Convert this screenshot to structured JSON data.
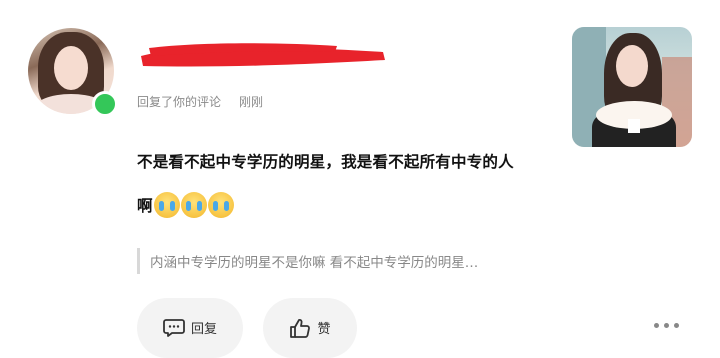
{
  "user": {
    "online_color": "#34c759",
    "action_text": "回复了你的评论",
    "time_text": "刚刚"
  },
  "comment": {
    "line1": "不是看不起中专学历的明星，我是看不起所有中专的人",
    "line2_text": "啊",
    "emoji_names": [
      "crying-face-icon",
      "crying-face-icon",
      "crying-face-icon"
    ]
  },
  "quoted": {
    "text": "内涵中专学历的明星不是你嘛 看不起中专学历的明星…"
  },
  "actions": {
    "reply_label": "回复",
    "like_label": "赞"
  },
  "colors": {
    "redaction": "#e8232b",
    "meta_text": "#8a8a8a"
  }
}
